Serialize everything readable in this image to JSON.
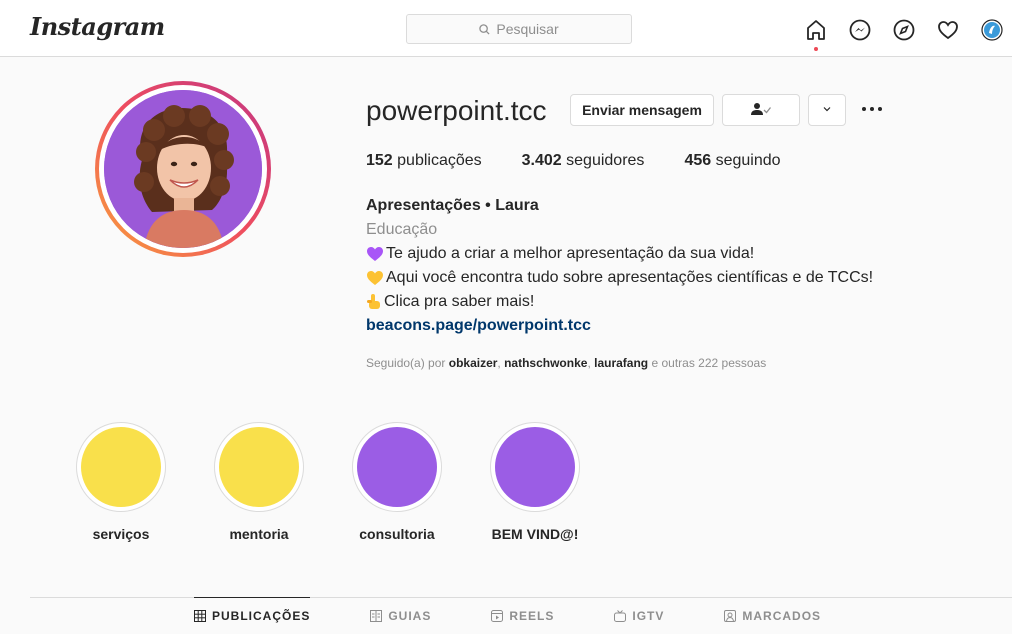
{
  "app": {
    "logo": "Instagram"
  },
  "search": {
    "placeholder": "Pesquisar"
  },
  "nav": {
    "icons": [
      "home-icon",
      "messenger-icon",
      "explore-icon",
      "activity-heart-icon",
      "profile-avatar-icon"
    ]
  },
  "profile": {
    "username": "powerpoint.tcc",
    "message_button": "Enviar mensagem",
    "stats": {
      "posts_count": "152",
      "posts_label": "publicações",
      "followers_count": "3.402",
      "followers_label": "seguidores",
      "following_count": "456",
      "following_label": "seguindo"
    },
    "bio": {
      "name": "Apresentações • Laura",
      "category": "Educação",
      "line1": "Te ajudo a criar a melhor apresentação da sua vida!",
      "line2": "Aqui você encontra tudo sobre apresentações científicas e de TCCs!",
      "line3": "Clica pra saber mais!",
      "link": "beacons.page/powerpoint.tcc"
    },
    "followed_by": {
      "prefix": "Seguido(a) por",
      "user1": "obkaizer",
      "user2": "nathschwonke",
      "user3": "laurafang",
      "suffix": "e outras 222 pessoas"
    }
  },
  "highlights": [
    {
      "label": "serviços",
      "color": "#f9e04b"
    },
    {
      "label": "mentoria",
      "color": "#f9e04b"
    },
    {
      "label": "consultoria",
      "color": "#9b5de5"
    },
    {
      "label": "BEM VIND@!",
      "color": "#9b5de5"
    }
  ],
  "tabs": [
    {
      "label": "PUBLICAÇÕES",
      "active": true
    },
    {
      "label": "GUIAS",
      "active": false
    },
    {
      "label": "REELS",
      "active": false
    },
    {
      "label": "IGTV",
      "active": false
    },
    {
      "label": "MARCADOS",
      "active": false
    }
  ],
  "colors": {
    "accent_link": "#00376b",
    "notification_dot": "#ed4956",
    "highlight_yellow": "#f9e04b",
    "highlight_purple": "#9b5de5",
    "avatar_bg": "#9b59d8"
  }
}
